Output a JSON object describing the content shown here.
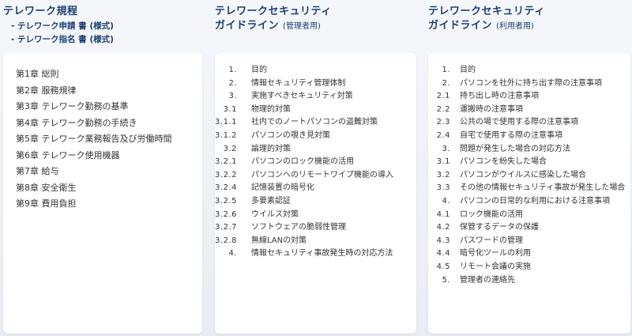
{
  "col1": {
    "title": "テレワーク規程",
    "sub": [
      "- テレワーク申請 書 (様式)",
      "- テレワーク指名 書 (様式)"
    ],
    "chapters": [
      "第1章 総則",
      "第2章 服務規律",
      "第3章 テレワーク勤務の基準",
      "第4章 テレワーク勤務の手続き",
      "第5章 テレワーク業務報告及び労働時間",
      "第6章 テレワーク使用機器",
      "第7章 給与",
      "第8章 安全衛生",
      "第9章 費用負担"
    ]
  },
  "col2": {
    "title_line1": "テレワークセキュリティ",
    "title_line2": "ガイドライン",
    "title_sub": "(管理者用)",
    "items": [
      {
        "num": "1.",
        "text": "目的"
      },
      {
        "num": "2.",
        "text": "情報セキュリティ管理体制"
      },
      {
        "num": "3.",
        "text": "実施すべきセキュリティ対策"
      },
      {
        "num": "3.1",
        "text": "物理的対策"
      },
      {
        "num": "3.1.1",
        "text": "社内でのノートパソコンの盗難対策"
      },
      {
        "num": "3.1.2",
        "text": "パソコンの覗き見対策"
      },
      {
        "num": "3.2",
        "text": "論理的対策"
      },
      {
        "num": "3.2.1",
        "text": "パソコンのロック機能の活用"
      },
      {
        "num": "3.2.2",
        "text": "パソコンへのリモートワイプ機能の導入"
      },
      {
        "num": "3.2.4",
        "text": "記憶装置の暗号化"
      },
      {
        "num": "3.2.5",
        "text": "多要素認証"
      },
      {
        "num": "3.2.6",
        "text": "ウイルス対策"
      },
      {
        "num": "3.2.7",
        "text": "ソフトウェアの脆弱性管理"
      },
      {
        "num": "3.2.8",
        "text": "無線LANの対策"
      },
      {
        "num": "4.",
        "text": "情報セキュリティ事故発生時の対応方法"
      }
    ]
  },
  "col3": {
    "title_line1": "テレワークセキュリティ",
    "title_line2": "ガイドライン",
    "title_sub": "(利用者用)",
    "items": [
      {
        "num": "1.",
        "text": "目的"
      },
      {
        "num": "2.",
        "text": "パソコンを社外に持ち出す際の注意事項"
      },
      {
        "num": "2.1",
        "text": "持ち出し時の注意事項"
      },
      {
        "num": "2.2",
        "text": "運搬時の注意事項"
      },
      {
        "num": "2.3",
        "text": "公共の場で使用する際の注意事項"
      },
      {
        "num": "2.4",
        "text": "自宅で使用する際の注意事項"
      },
      {
        "num": "3.",
        "text": "問題が発生した場合の対応方法"
      },
      {
        "num": "3.1",
        "text": "パソコンを紛失した場合"
      },
      {
        "num": "3.2",
        "text": "パソコンがウイルスに感染した場合"
      },
      {
        "num": "3.3",
        "text": "その他の情報セキュリティ事故が発生した場合"
      },
      {
        "num": "4.",
        "text": "パソコンの日常的な利用における注意事項"
      },
      {
        "num": "4.1",
        "text": "ロック機能の活用"
      },
      {
        "num": "4.2",
        "text": "保管するデータの保護"
      },
      {
        "num": "4.3",
        "text": "パスワードの管理"
      },
      {
        "num": "4.4",
        "text": "暗号化ツールの利用"
      },
      {
        "num": "4.5",
        "text": "リモート会議の実施"
      },
      {
        "num": "5.",
        "text": "管理者の連絡先"
      }
    ]
  }
}
